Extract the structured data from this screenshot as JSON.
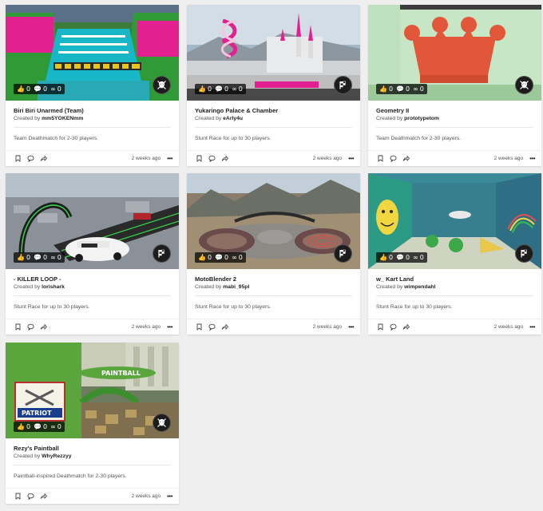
{
  "jobs": [
    {
      "title": "Biri Biri Unarmed (Team)",
      "creator_prefix": "Created by",
      "creator": "mm5YOKENmm",
      "description": "Team Deathmatch for 2-30 players.",
      "likes": "0",
      "comments": "0",
      "views": "0",
      "ago": "2 weeks ago",
      "badge_icon": "skull-icon"
    },
    {
      "title": "Yukaringo Palace & Chamber",
      "creator_prefix": "Created by",
      "creator": "eArly4u",
      "description": "Stunt Race for up to 30 players.",
      "likes": "0",
      "comments": "0",
      "views": "0",
      "ago": "2 weeks ago",
      "badge_icon": "race-flag-icon"
    },
    {
      "title": "Geometry II",
      "creator_prefix": "Created by",
      "creator": "prototypetom",
      "description": "Team Deathmatch for 2-30 players.",
      "likes": "0",
      "comments": "0",
      "views": "0",
      "ago": "2 weeks ago",
      "badge_icon": "skull-icon"
    },
    {
      "title": "- KILLER LOOP -",
      "creator_prefix": "Created by",
      "creator": "lorishark",
      "description": "Stunt Race for up to 30 players.",
      "likes": "0",
      "comments": "0",
      "views": "0",
      "ago": "2 weeks ago",
      "badge_icon": "race-flag-icon"
    },
    {
      "title": "MotoBlender 2",
      "creator_prefix": "Created by",
      "creator": "mabi_95pl",
      "description": "Stunt Race for up to 30 players.",
      "likes": "0",
      "comments": "0",
      "views": "0",
      "ago": "2 weeks ago",
      "badge_icon": "race-flag-icon"
    },
    {
      "title": "w_ Kart Land",
      "creator_prefix": "Created by",
      "creator": "wimpendahl",
      "description": "Stunt Race for up to 30 players.",
      "likes": "0",
      "comments": "0",
      "views": "0",
      "ago": "2 weeks ago",
      "badge_icon": "race-flag-icon"
    },
    {
      "title": "Rezy's Paintball",
      "creator_prefix": "Created by",
      "creator": "WhyRezzyy",
      "description": "Paintball-inspired Deathmatch for 2-30 players.",
      "likes": "0",
      "comments": "0",
      "views": "0",
      "ago": "2 weeks ago",
      "badge_icon": "skull-icon"
    }
  ],
  "thumb_texts": {
    "patriot": "PATRIOT",
    "paintball": "PAINTBALL"
  },
  "action_icons": [
    "bookmark-icon",
    "comment-icon",
    "share-icon"
  ],
  "more_label": "•••",
  "colors": {
    "page_bg": "#efefef",
    "card_bg": "#ffffff",
    "badge_bg": "#1c1c1c"
  }
}
